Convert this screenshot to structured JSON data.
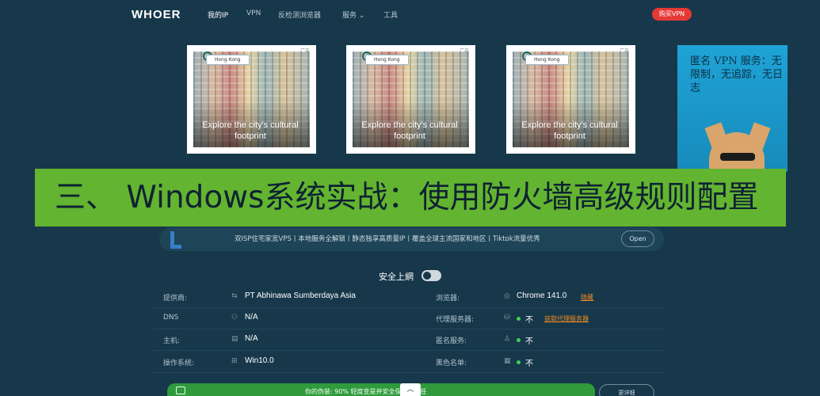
{
  "nav": {
    "logo": "WHOER",
    "items": [
      "我的IP",
      "VPN",
      "反检测浏览器",
      "服务 ⌄",
      "工具"
    ],
    "buy": "购买VPN"
  },
  "ads": [
    {
      "tag": "Hong Kong",
      "label": "广告",
      "caption": "Explore the city's cultural footprint"
    },
    {
      "tag": "Hong Kong",
      "label": "广告",
      "caption": "Explore the city's cultural footprint"
    },
    {
      "tag": "Hong Kong",
      "label": "广告",
      "caption": "Explore the city's cultural footprint"
    }
  ],
  "side_ad": {
    "title": "匿名 VPN 服务：无限制，无追踪，无日志"
  },
  "banner": "三、 Windows系统实战：使用防火墙高级规则配置",
  "promo": {
    "text": "双ISP住宅家宽VPS丨本地服务全解锁丨静态独享高质量IP丨覆盖全球主流国家和地区丨Tiktok流量优秀",
    "open": "Open"
  },
  "secure": {
    "label": "安全上網",
    "on": false
  },
  "left_rows": [
    {
      "label": "提供商:",
      "icon": "network-icon",
      "value": "PT Abhinawa Sumberdaya Asia"
    },
    {
      "label": "DNS",
      "icon": "dns-icon",
      "value": "N/A"
    },
    {
      "label": "主机:",
      "icon": "host-icon",
      "value": "N/A"
    },
    {
      "label": "操作系统:",
      "icon": "windows-icon",
      "value": "Win10.0"
    }
  ],
  "right_rows": [
    {
      "label": "浏览器:",
      "icon": "browser-icon",
      "value": "Chrome 141.0",
      "link": "隐藏"
    },
    {
      "label": "代理服务器:",
      "icon": "proxy-icon",
      "value": "不",
      "link": "获取代理服务器",
      "status_color": "#3ecf5e"
    },
    {
      "label": "匿名服务:",
      "icon": "anonymizer-icon",
      "value": "不",
      "status_color": "#3ecf5e"
    },
    {
      "label": "黑色名单:",
      "icon": "blacklist-icon",
      "value": "不",
      "status_color": "#3ecf5e"
    }
  ],
  "bottom": {
    "text": "你的伪装: 90% 轻度变是并安全保护安全任",
    "more": "更详细",
    "up": "︿"
  },
  "colors": {
    "background": "#17384a",
    "accent_green": "#63b430",
    "buy_red": "#e53935",
    "link_orange": "#f08a24"
  }
}
